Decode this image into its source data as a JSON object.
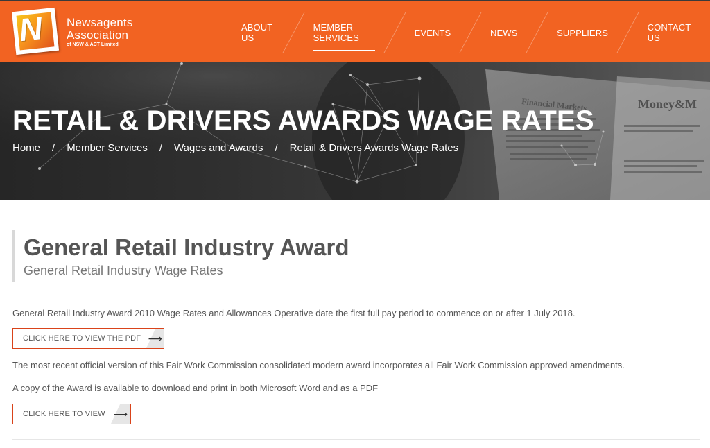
{
  "brand": {
    "logo_letter": "N",
    "name_line1": "Newsagents",
    "name_line2": "Association",
    "name_line3": "of NSW & ACT Limited",
    "accent_color": "#f26322"
  },
  "nav": {
    "items": [
      {
        "label": "ABOUT US"
      },
      {
        "label": "MEMBER SERVICES",
        "active": true
      },
      {
        "label": "EVENTS"
      },
      {
        "label": "NEWS"
      },
      {
        "label": "SUPPLIERS"
      },
      {
        "label": "CONTACT US"
      }
    ]
  },
  "hero": {
    "title": "RETAIL & DRIVERS AWARDS WAGE RATES",
    "breadcrumb": [
      "Home",
      "Member Services",
      "Wages and Awards",
      "Retail & Drivers Awards Wage Rates"
    ],
    "breadcrumb_separator": "/",
    "newspaper_text": [
      "Money&M",
      "Financial Markets"
    ]
  },
  "content": {
    "award_title": "General Retail Industry Award",
    "award_subtitle": "General Retail Industry Wage Rates",
    "para1": "General Retail Industry Award 2010 Wage Rates and Allowances Operative date the first full pay period to commence on or after 1 July 2018.",
    "button1": "CLICK HERE TO VIEW THE PDF",
    "para2": "The most recent official version of this Fair Work Commission consolidated modern award incorporates all Fair Work Commission approved amendments.",
    "para3": "A copy of the Award is available to download and print in both Microsoft Word and as a PDF",
    "button2": "CLICK HERE TO VIEW",
    "arrow_glyph": "⟶",
    "arrow_icon": "arrow-right-icon"
  }
}
